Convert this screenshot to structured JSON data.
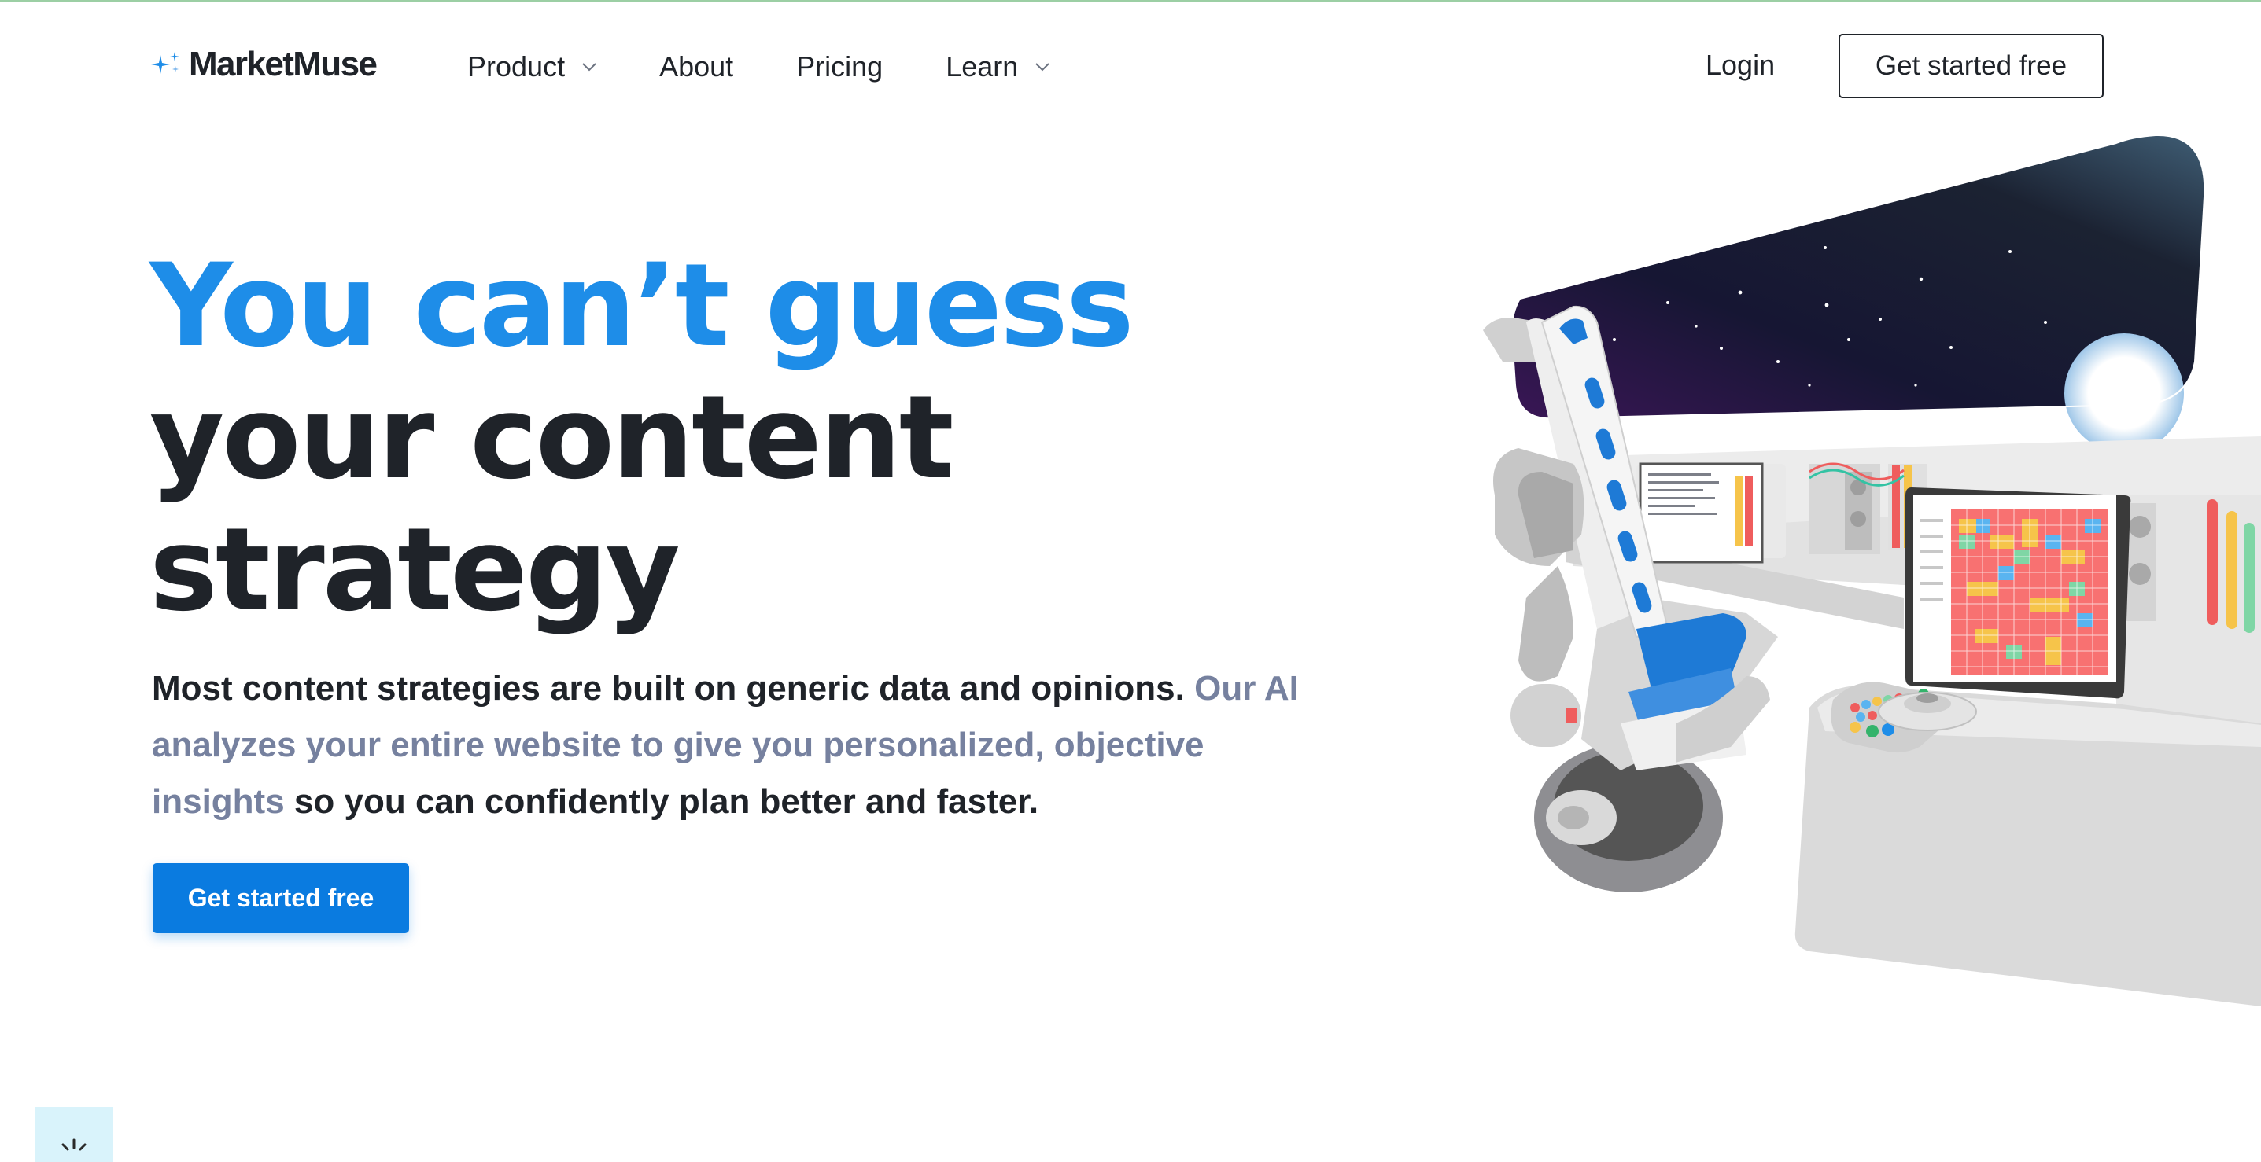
{
  "brand": {
    "name": "MarketMuse",
    "icon": "sparkle-icon",
    "accent": "#1e8de8"
  },
  "nav": {
    "items": [
      {
        "label": "Product",
        "has_dropdown": true
      },
      {
        "label": "About",
        "has_dropdown": false
      },
      {
        "label": "Pricing",
        "has_dropdown": false
      },
      {
        "label": "Learn",
        "has_dropdown": true
      }
    ],
    "login_label": "Login",
    "cta_label": "Get started free"
  },
  "hero": {
    "title_line1": "You can’t guess",
    "title_line2": "your content",
    "title_line3": "strategy",
    "subtitle_part1": "Most content strategies are built on generic data and opinions.",
    "subtitle_highlight": "Our AI analyzes your entire website to give you personalized, objective insights",
    "subtitle_part2": "so you can confidently plan better and faster.",
    "cta_label": "Get started free"
  },
  "colors": {
    "primary": "#0a7be0",
    "heading_blue": "#1e8de8",
    "text_dark": "#1f2329",
    "text_muted": "#76819f"
  },
  "illustration": {
    "subject": "astronaut-cockpit-illustration"
  },
  "widget": {
    "icon": "loading-spinner-icon"
  }
}
